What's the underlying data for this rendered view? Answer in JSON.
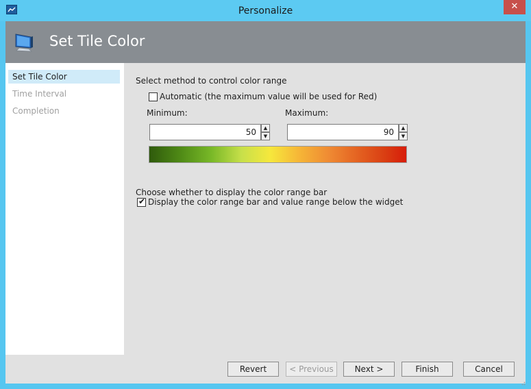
{
  "window": {
    "title": "Personalize",
    "close_glyph": "✕"
  },
  "header": {
    "title": "Set Tile Color",
    "icon": "monitor-icon"
  },
  "nav": {
    "items": [
      {
        "label": "Set Tile Color",
        "active": true
      },
      {
        "label": "Time Interval",
        "active": false
      },
      {
        "label": "Completion",
        "active": false
      }
    ]
  },
  "content": {
    "method_label": "Select method to control color range",
    "automatic_label": "Automatic (the maximum value will be used for Red)",
    "automatic_checked": false,
    "minimum_label": "Minimum:",
    "minimum_value": "50",
    "maximum_label": "Maximum:",
    "maximum_value": "90",
    "display_label": "Choose whether to display the color range bar",
    "display_checkbox_label": "Display the color range bar and value range below the widget",
    "display_checked": true,
    "check_glyph": "✔",
    "spin_up_glyph": "▲",
    "spin_down_glyph": "▼"
  },
  "footer": {
    "revert": "Revert",
    "previous": "< Previous",
    "next": "Next >",
    "finish": "Finish",
    "cancel": "Cancel"
  },
  "colors": {
    "title_bar": "#5ccaf2",
    "header_band": "#888d92",
    "nav_active": "#d0ebf9",
    "close_button": "#c7504b"
  }
}
